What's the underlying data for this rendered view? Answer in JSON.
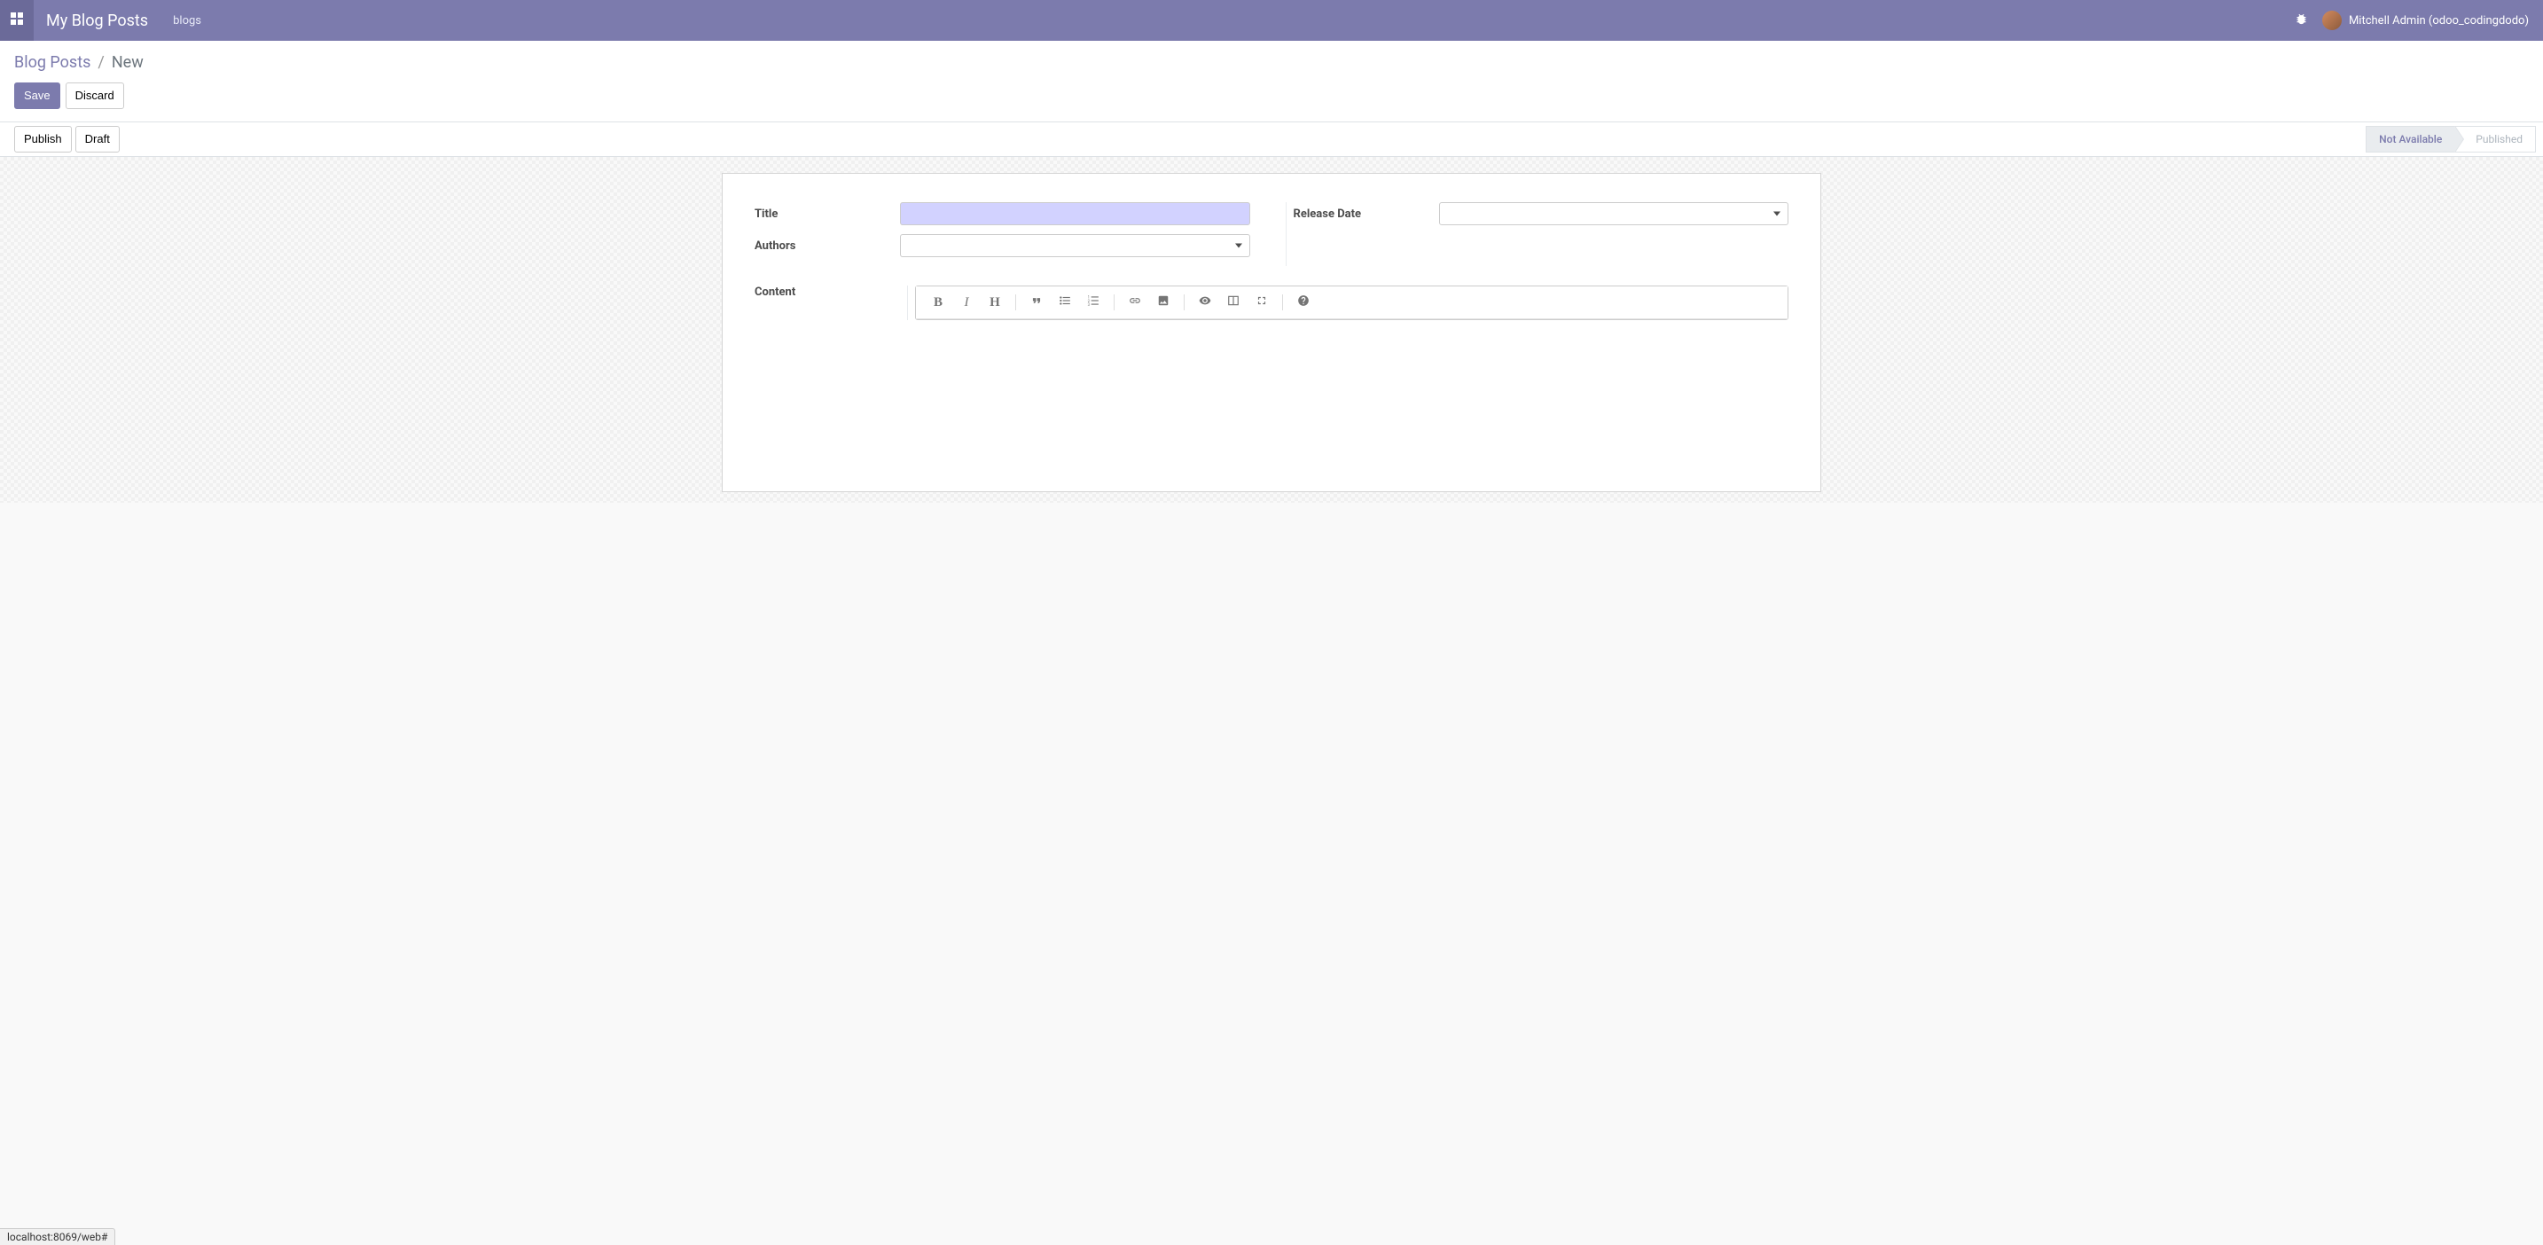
{
  "navbar": {
    "title": "My Blog Posts",
    "menu_item": "blogs",
    "user_display": "Mitchell Admin (odoo_codingdodo)"
  },
  "breadcrumb": {
    "parent": "Blog Posts",
    "separator": "/",
    "current": "New"
  },
  "buttons": {
    "save": "Save",
    "discard": "Discard",
    "publish": "Publish",
    "draft": "Draft"
  },
  "status": {
    "not_available": "Not Available",
    "published": "Published"
  },
  "fields": {
    "title_label": "Title",
    "authors_label": "Authors",
    "release_date_label": "Release Date",
    "content_label": "Content",
    "title_value": "",
    "authors_value": "",
    "release_date_value": ""
  },
  "link_hint": "localhost:8069/web#"
}
